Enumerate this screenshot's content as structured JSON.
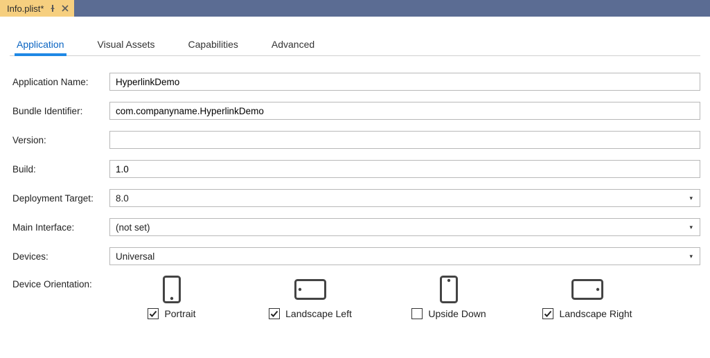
{
  "fileTab": {
    "title": "Info.plist*"
  },
  "tabs": {
    "application": "Application",
    "visual_assets": "Visual Assets",
    "capabilities": "Capabilities",
    "advanced": "Advanced"
  },
  "fields": {
    "application_name": {
      "label": "Application Name:",
      "value": "HyperlinkDemo"
    },
    "bundle_identifier": {
      "label": "Bundle Identifier:",
      "value": "com.companyname.HyperlinkDemo"
    },
    "version": {
      "label": "Version:",
      "value": ""
    },
    "build": {
      "label": "Build:",
      "value": "1.0"
    },
    "deployment_target": {
      "label": "Deployment Target:",
      "value": "8.0"
    },
    "main_interface": {
      "label": "Main Interface:",
      "value": "(not set)"
    },
    "devices": {
      "label": "Devices:",
      "value": "Universal"
    },
    "device_orientation": {
      "label": "Device Orientation:"
    }
  },
  "orientation": {
    "portrait": {
      "label": "Portrait",
      "checked": true
    },
    "landscape_left": {
      "label": "Landscape Left",
      "checked": true
    },
    "upside_down": {
      "label": "Upside Down",
      "checked": false
    },
    "landscape_right": {
      "label": "Landscape Right",
      "checked": true
    }
  }
}
